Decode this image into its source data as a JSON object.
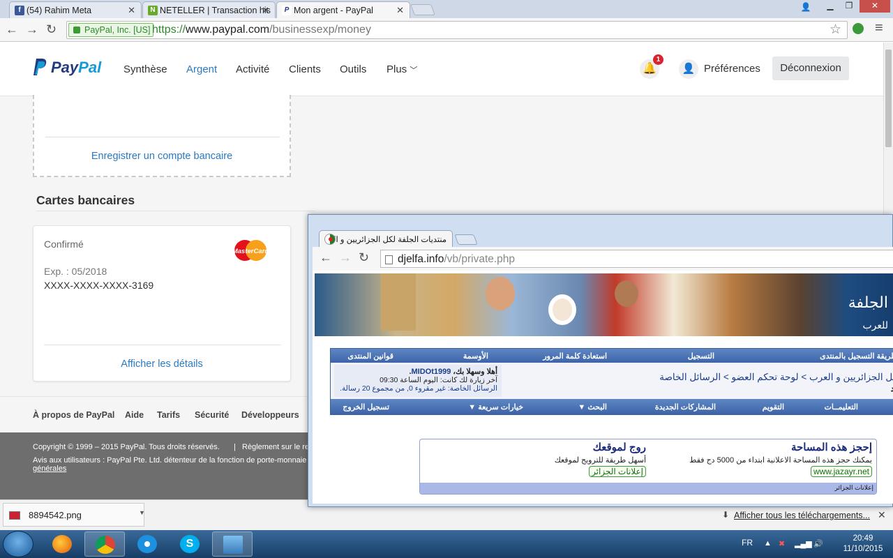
{
  "browser": {
    "tabs": [
      {
        "label": "(54) Rahim Meta",
        "icon": "facebook-icon",
        "color": "#3b5998"
      },
      {
        "label": "NETELLER | Transaction his",
        "icon": "neteller-icon",
        "color": "#6aaa2a"
      },
      {
        "label": "Mon argent - PayPal",
        "icon": "paypal-icon",
        "color": "#253b80"
      }
    ],
    "ev_badge": "PayPal, Inc. [US]",
    "url_scheme": "https://",
    "url_host": "www.paypal.com",
    "url_path": "/businessexp/money"
  },
  "paypal": {
    "logo_a": "Pay",
    "logo_b": "Pal",
    "nav": [
      "Synthèse",
      "Argent",
      "Activité",
      "Clients",
      "Outils",
      "Plus"
    ],
    "active_nav": "Argent",
    "notification_count": "1",
    "preferences": "Préférences",
    "logout": "Déconnexion",
    "register_bank": "Enregistrer un compte bancaire",
    "cards_title": "Cartes bancaires",
    "card": {
      "status": "Confirmé",
      "expiry": "Exp. : 05/2018",
      "number": "XXXX-XXXX-XXXX-3169",
      "brand": "MasterCard",
      "details_link": "Afficher les détails"
    },
    "footer_links": [
      "À propos de PayPal",
      "Aide",
      "Tarifs",
      "Sécurité",
      "Développeurs"
    ],
    "copyright": "Copyright © 1999 – 2015 PayPal. Tous droits réservés.",
    "regulation": "Règlement sur le re",
    "notice": "Avis aux utilisateurs : PayPal Pte. Ltd. détenteur de la fonction de porte-monnaie é",
    "notice_link": "générales"
  },
  "downloads": {
    "file": "8894542.png",
    "show_all": "Afficher tous les téléchargements..."
  },
  "taskbar": {
    "language": "FR",
    "time": "20:49",
    "date": "11/10/2015"
  },
  "popup": {
    "tab_title": "منتديات الجلفة لكل الجزائريين و الـ",
    "url_host": "djelfa.info",
    "url_path": "/vb/private.php",
    "banner_logo": "الجلفة",
    "banner_sub": "للعرب",
    "nav_top": [
      "طريقة التسجيل بالمنتدى",
      "التسجيل",
      "استعادة كلمة المرور",
      "الأوسمة",
      "قوانين المنتدى"
    ],
    "welcome_user": "أهلا وسهلا بك",
    "username": "MIDOt1999",
    "last_visit": "آخر زيارة لك كانت: اليوم الساعة 09:30",
    "private_msgs": "الرسائل الخاصة: غير مقروء 0, من مجموع 20 رسالة.",
    "breadcrumb": "ة لكل الجزائريين و العرب > لوحة تحكم العضو > الرسائل الخاصة",
    "breadcrumb_sub": "د",
    "nav_bottom": [
      "التعليمــات",
      "التقويم",
      "المشاركات الجديدة",
      "البحث",
      "خيارات سريعة",
      "تسجيل الخروج"
    ],
    "ad1_title": "إحجز هذه المساحة",
    "ad1_desc": "يمكنك حجز هذه المساحة الاعلانية ابتداء من 5000 دج فقط",
    "ad1_link": "www.jazayr.net",
    "ad2_title": "روج لموقعك",
    "ad2_desc": "أسهل طريقة للترويج لموقعك",
    "ad2_link": "إعلانات الجزائر",
    "ad_footer": "إعلانات الجزائر"
  }
}
